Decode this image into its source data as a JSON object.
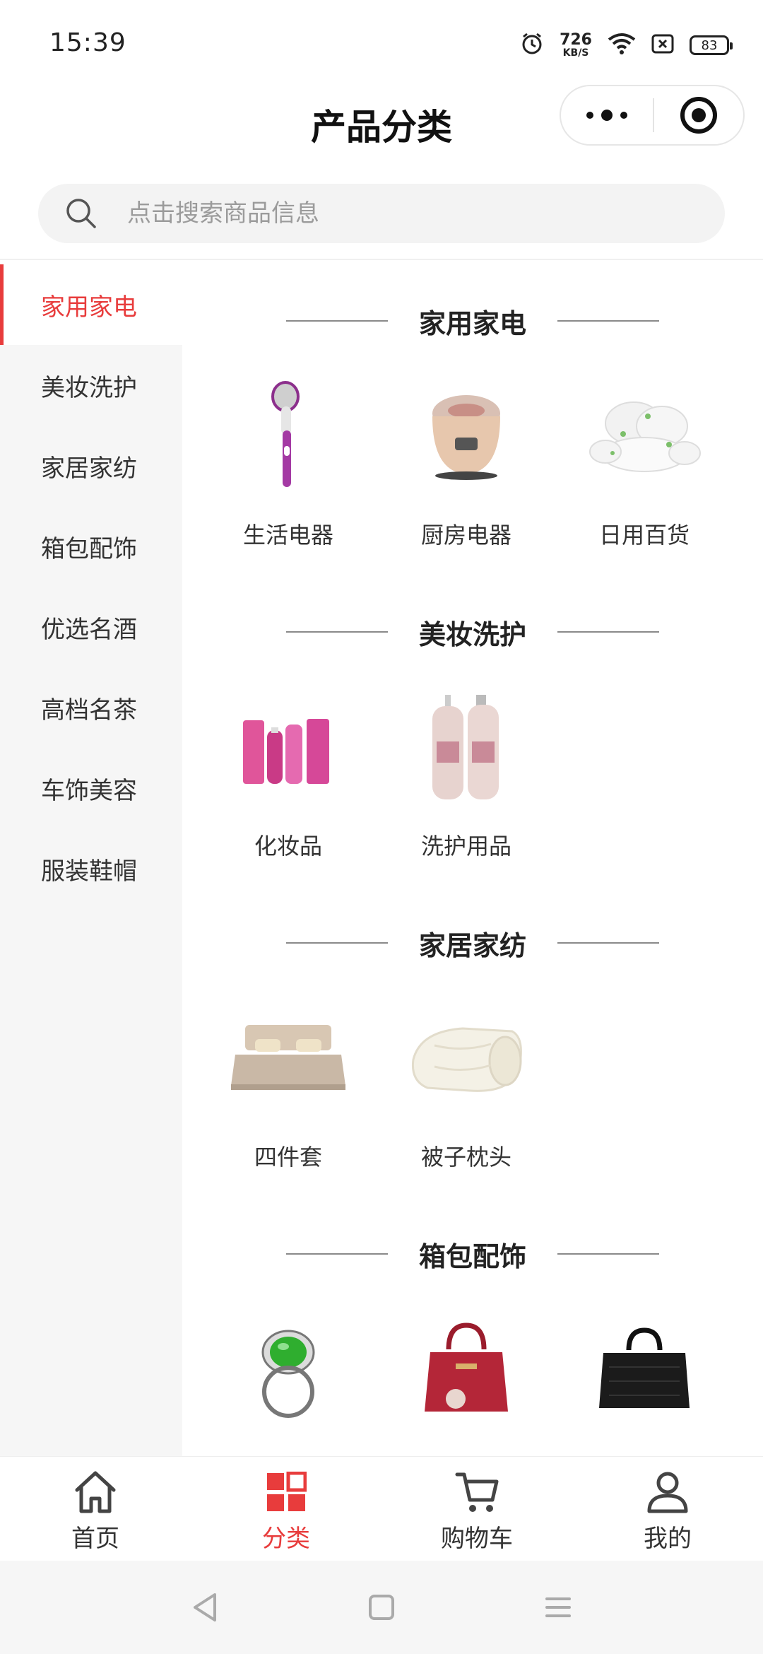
{
  "status": {
    "time": "15:39",
    "speed_value": "726",
    "speed_unit": "KB/S",
    "battery": "83"
  },
  "header": {
    "title": "产品分类"
  },
  "search": {
    "placeholder": "点击搜索商品信息"
  },
  "sidebar": {
    "items": [
      {
        "label": "家用家电",
        "active": true
      },
      {
        "label": "美妆洗护"
      },
      {
        "label": "家居家纺"
      },
      {
        "label": "箱包配饰"
      },
      {
        "label": "优选名酒"
      },
      {
        "label": "高档名茶"
      },
      {
        "label": "车饰美容"
      },
      {
        "label": "服装鞋帽"
      }
    ]
  },
  "sections": [
    {
      "title": "家用家电",
      "items": [
        {
          "label": "生活电器"
        },
        {
          "label": "厨房电器"
        },
        {
          "label": "日用百货"
        }
      ]
    },
    {
      "title": "美妆洗护",
      "items": [
        {
          "label": "化妆品"
        },
        {
          "label": "洗护用品"
        }
      ]
    },
    {
      "title": "家居家纺",
      "items": [
        {
          "label": "四件套"
        },
        {
          "label": "被子枕头"
        }
      ]
    },
    {
      "title": "箱包配饰",
      "items": [
        {
          "label": ""
        },
        {
          "label": ""
        },
        {
          "label": ""
        }
      ]
    }
  ],
  "tabbar": {
    "items": [
      {
        "label": "首页",
        "icon": "home-icon"
      },
      {
        "label": "分类",
        "icon": "category-icon",
        "active": true
      },
      {
        "label": "购物车",
        "icon": "cart-icon"
      },
      {
        "label": "我的",
        "icon": "user-icon"
      }
    ]
  },
  "colors": {
    "accent": "#e83c3c",
    "sidebar_bg": "#f6f6f6"
  }
}
